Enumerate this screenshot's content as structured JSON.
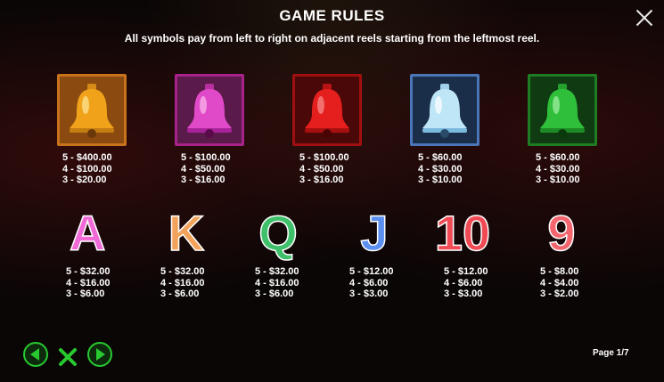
{
  "header": {
    "title": "GAME RULES",
    "subtitle": "All symbols pay from left to right on adjacent reels starting from the leftmost reel."
  },
  "symbols": [
    {
      "name": "gold-bell",
      "color": "#f0a21a",
      "frame": "#c9721e",
      "pays": [
        "5 - $400.00",
        "4 - $100.00",
        "3 - $20.00"
      ]
    },
    {
      "name": "pink-bell",
      "color": "#e04ac8",
      "frame": "#a8228c",
      "pays": [
        "5 - $100.00",
        "4 - $50.00",
        "3 - $16.00"
      ]
    },
    {
      "name": "red-bell",
      "color": "#e51e1e",
      "frame": "#a01010",
      "pays": [
        "5 - $100.00",
        "4 - $50.00",
        "3 - $16.00"
      ]
    },
    {
      "name": "blue-bell",
      "color": "#bfe6f7",
      "frame": "#4a76b8",
      "pays": [
        "5 - $60.00",
        "4 - $30.00",
        "3 - $10.00"
      ]
    },
    {
      "name": "green-bell",
      "color": "#2fbf3a",
      "frame": "#1e7d23",
      "pays": [
        "5 - $60.00",
        "4 - $30.00",
        "3 - $10.00"
      ]
    },
    {
      "name": "A",
      "color": "#ef6ad6",
      "pays": [
        "5 - $32.00",
        "4 - $16.00",
        "3 - $6.00"
      ]
    },
    {
      "name": "K",
      "color": "#f2a25a",
      "pays": [
        "5 - $32.00",
        "4 - $16.00",
        "3 - $6.00"
      ]
    },
    {
      "name": "Q",
      "color": "#3fc06a",
      "pays": [
        "5 - $32.00",
        "4 - $16.00",
        "3 - $6.00"
      ]
    },
    {
      "name": "J",
      "color": "#5b8ff0",
      "pays": [
        "5 - $12.00",
        "4 - $6.00",
        "3 - $3.00"
      ]
    },
    {
      "name": "10",
      "color": "#f04a55",
      "pays": [
        "5 - $12.00",
        "4 - $6.00",
        "3 - $3.00"
      ]
    },
    {
      "name": "9",
      "color": "#f5656e",
      "pays": [
        "5 - $8.00",
        "4 - $4.00",
        "3 - $2.00"
      ]
    }
  ],
  "footer": {
    "page": "Page 1/7"
  },
  "icons": {
    "close": "close-icon",
    "prev": "arrow-left-icon",
    "next": "arrow-right-icon",
    "exit": "green-x-icon"
  },
  "accent": "#28c830"
}
